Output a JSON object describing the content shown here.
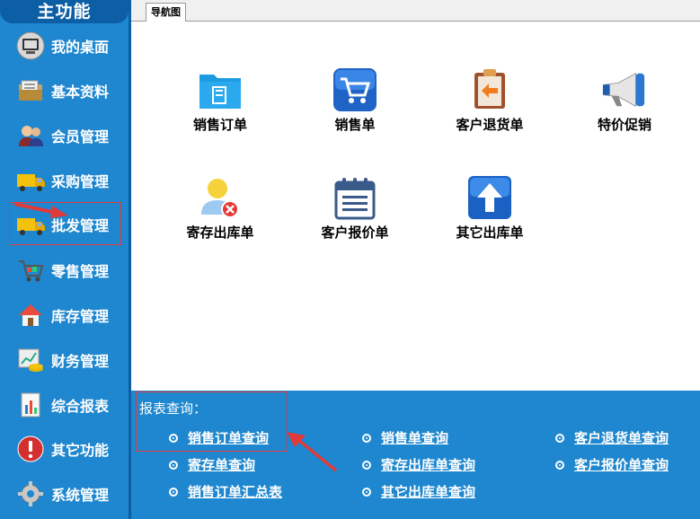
{
  "sidebar": {
    "title": "主功能",
    "items": [
      {
        "label": "我的桌面",
        "icon": "desktop-monitor-icon"
      },
      {
        "label": "基本资料",
        "icon": "folder-documents-icon"
      },
      {
        "label": "会员管理",
        "icon": "members-icon"
      },
      {
        "label": "采购管理",
        "icon": "truck-icon"
      },
      {
        "label": "批发管理",
        "icon": "truck-icon"
      },
      {
        "label": "零售管理",
        "icon": "shopping-cart-icon"
      },
      {
        "label": "库存管理",
        "icon": "warehouse-house-icon"
      },
      {
        "label": "财务管理",
        "icon": "finance-chart-icon"
      },
      {
        "label": "综合报表",
        "icon": "report-bar-chart-icon"
      },
      {
        "label": "其它功能",
        "icon": "exclamation-icon"
      },
      {
        "label": "系统管理",
        "icon": "gear-icon"
      }
    ]
  },
  "tab": {
    "label": "导航图"
  },
  "nav": {
    "items": [
      {
        "label": "销售订单",
        "icon": "sales-order-folder-icon"
      },
      {
        "label": "销售单",
        "icon": "cart-icon"
      },
      {
        "label": "客户退货单",
        "icon": "return-clipboard-icon"
      },
      {
        "label": "特价促销",
        "icon": "megaphone-icon"
      },
      {
        "label": "寄存出库单",
        "icon": "user-remove-icon"
      },
      {
        "label": "客户报价单",
        "icon": "calendar-notepad-icon"
      },
      {
        "label": "其它出库单",
        "icon": "arrow-up-icon"
      }
    ]
  },
  "reports": {
    "title": "报表查询：",
    "links": [
      "销售订单查询",
      "销售单查询",
      "客户退货单查询",
      "寄存单查询",
      "寄存出库单查询",
      "客户报价单查询",
      "销售订单汇总表",
      "其它出库单查询"
    ]
  },
  "colors": {
    "sidebar_bg": "#1e87cf",
    "sidebar_title_bg": "#0d5fa5",
    "highlight": "#e03a3a"
  }
}
